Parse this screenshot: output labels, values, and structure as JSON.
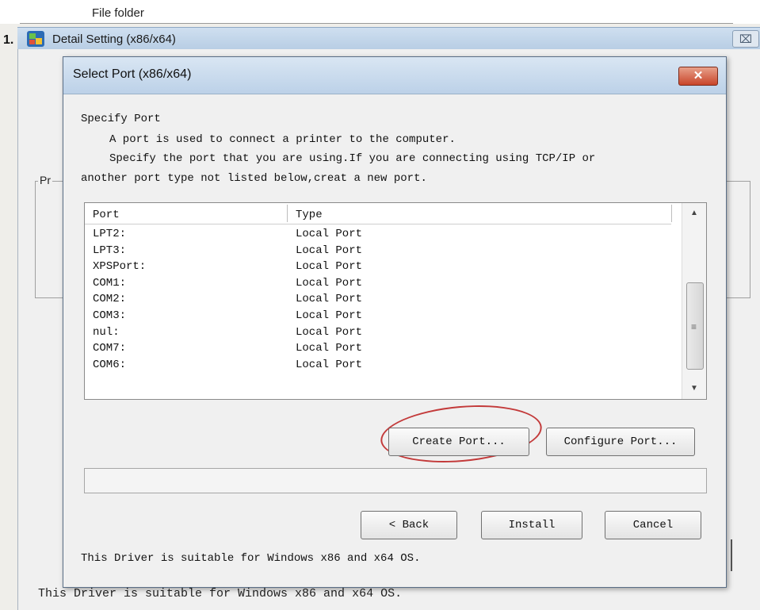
{
  "background": {
    "folder_text": "File folder",
    "step_number": "1.",
    "window_title": "Detail Setting (x86/x64)",
    "group_label": "Pr",
    "footer_text": "This Driver is suitable for Windows x86 and x64 OS.",
    "close_glyph": "⌧"
  },
  "dialog": {
    "title": "Select Port (x86/x64)",
    "close_glyph": "✕",
    "section_title": "Specify Port",
    "description_line1": "A port is used to connect a printer to the computer.",
    "description_line2": "Specify the port that you are using.If you are connecting using TCP/IP or",
    "description_line3": "another port type not listed below,creat a new port.",
    "table": {
      "headers": [
        "Port",
        "Type"
      ],
      "rows": [
        [
          "LPT2:",
          "Local Port"
        ],
        [
          "LPT3:",
          "Local Port"
        ],
        [
          "XPSPort:",
          "Local Port"
        ],
        [
          "COM1:",
          "Local Port"
        ],
        [
          "COM2:",
          "Local Port"
        ],
        [
          "COM3:",
          "Local Port"
        ],
        [
          "nul:",
          "Local Port"
        ],
        [
          "COM7:",
          "Local Port"
        ],
        [
          "COM6:",
          "Local Port"
        ]
      ]
    },
    "scrollbar": {
      "up": "▲",
      "down": "▼",
      "grip": "≡"
    },
    "buttons": {
      "create_port": "Create Port...",
      "configure_port": "Configure Port...",
      "back": "< Back",
      "install": "Install",
      "cancel": "Cancel"
    },
    "footer_text": "This Driver is suitable for Windows x86 and x64 OS."
  },
  "colors": {
    "highlight_ellipse": "#c33a3a",
    "close_button": "#c8452a"
  }
}
